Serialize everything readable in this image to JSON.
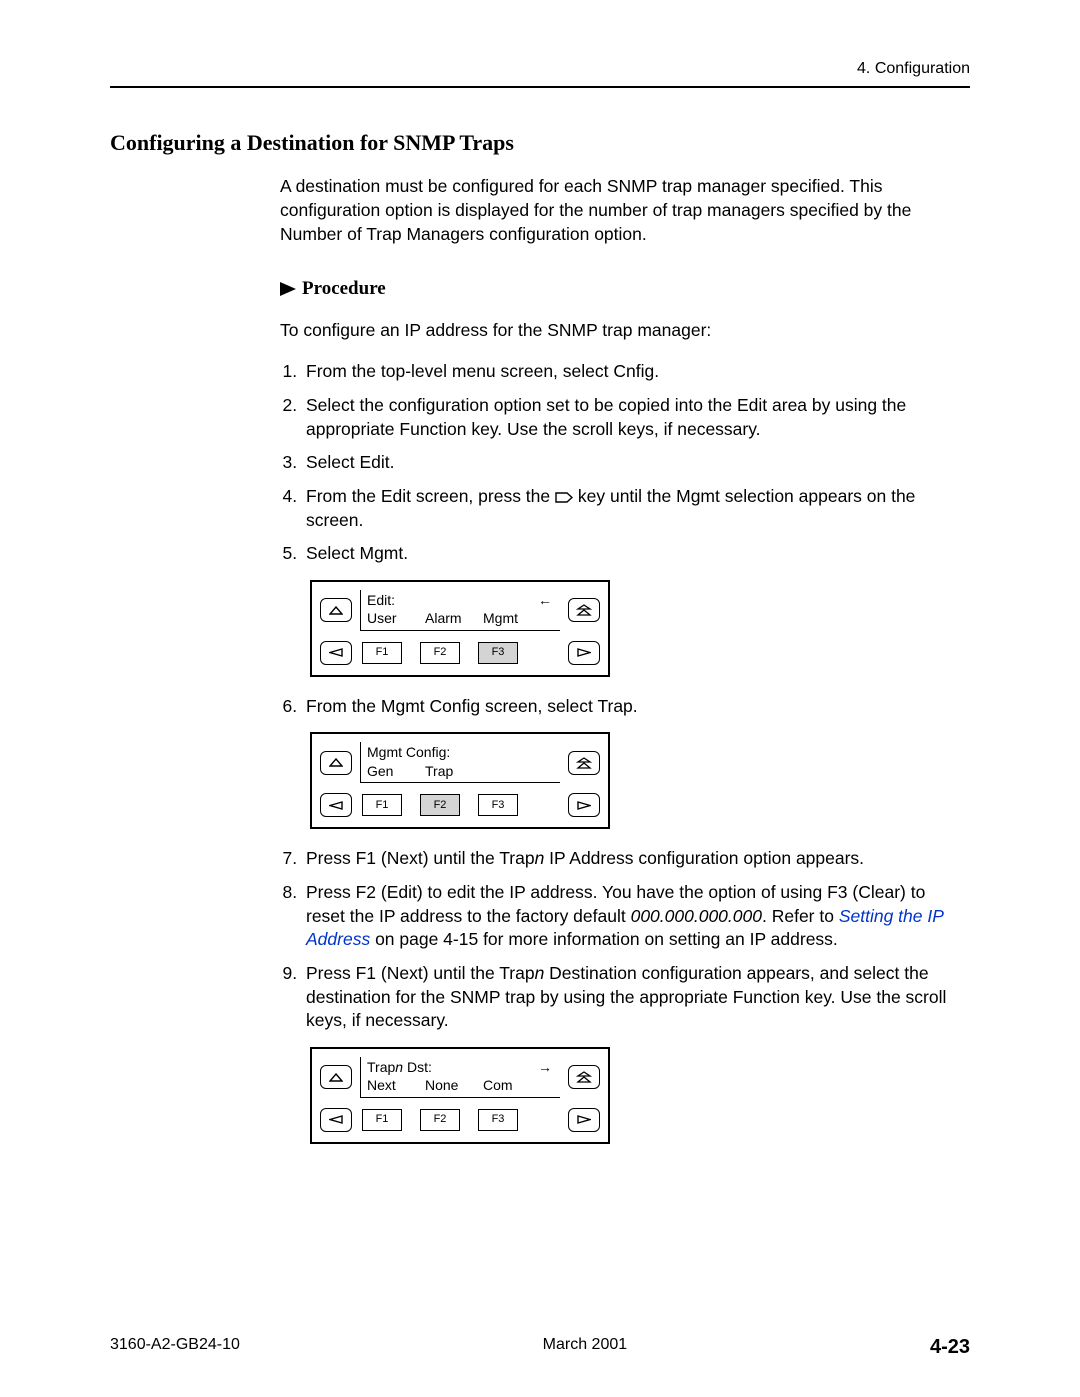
{
  "header": {
    "chapter": "4. Configuration"
  },
  "section": {
    "title": "Configuring a Destination for SNMP Traps"
  },
  "intro": "A destination must be configured for each SNMP trap manager specified. This configuration option is displayed for the number of trap managers specified by the Number of Trap Managers configuration option.",
  "procedure": {
    "label": "Procedure",
    "lead": "To configure an IP address for the SNMP trap manager:",
    "step1": "From the top-level menu screen, select Cnfig.",
    "step2": "Select the configuration option set to be copied into the Edit area by using the appropriate Function key. Use the scroll keys, if necessary.",
    "step3": "Select Edit.",
    "step4_a": "From the Edit screen, press the ",
    "step4_b": " key until the Mgmt selection appears on the screen.",
    "step5": "Select Mgmt.",
    "step6": "From the Mgmt Config screen, select Trap.",
    "step7_a": "Press F1 (Next) until the Trap",
    "step7_b": " IP Address configuration option appears.",
    "step8_a": "Press F2 (Edit) to edit the IP address. You have the option of using F3 (Clear) to reset the IP address to the factory default ",
    "step8_default": "000.000.000.000",
    "step8_b": ". Refer to ",
    "step8_link": "Setting the IP Address",
    "step8_c": " on page 4-15 for more information on setting an IP address.",
    "step9_a": "Press F1 (Next) until the Trap",
    "step9_b": " Destination configuration appears, and select the destination for the SNMP trap by using the appropriate Function key. Use the scroll keys, if necessary."
  },
  "panels": {
    "edit": {
      "title": "Edit:",
      "arrow": "←",
      "opt1": "User",
      "opt2": "Alarm",
      "opt3": "Mgmt",
      "f1": "F1",
      "f2": "F2",
      "f3": "F3"
    },
    "mgmt": {
      "title": "Mgmt Config:",
      "opt1": "Gen",
      "opt2": "Trap",
      "opt3": "",
      "f1": "F1",
      "f2": "F2",
      "f3": "F3"
    },
    "trap": {
      "title_a": "Trap",
      "title_b": " Dst:",
      "arrow": "→",
      "opt1": "Next",
      "opt2": "None",
      "opt3": "Com",
      "f1": "F1",
      "f2": "F2",
      "f3": "F3"
    }
  },
  "footer": {
    "doc": "3160-A2-GB24-10",
    "date": "March 2001",
    "page": "4-23"
  }
}
